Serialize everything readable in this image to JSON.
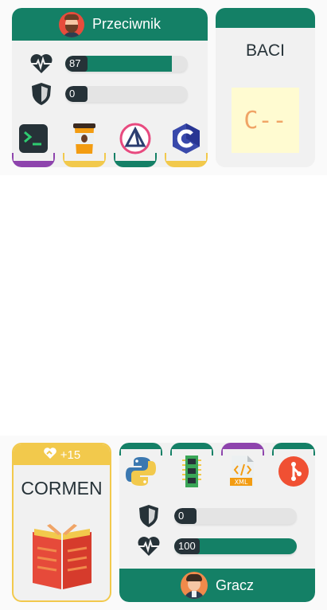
{
  "opponent": {
    "name": "Przeciwnik",
    "health": 87,
    "health_fraction": 0.87,
    "shield": 0,
    "shield_fraction": 0,
    "hand": [
      {
        "icon": "terminal-icon",
        "color": "#8e44ad"
      },
      {
        "icon": "coffee-cup-icon",
        "color": "#f2c94c"
      },
      {
        "icon": "triangle-logo-icon",
        "color": "#148066"
      },
      {
        "icon": "c-language-icon",
        "color": "#f2c94c"
      }
    ]
  },
  "opponent_card": {
    "title": "BACI",
    "art_text": "C--",
    "header_color": "#148066"
  },
  "player_card": {
    "bonus": "+15",
    "title": "CORMEN",
    "art_icon": "book-icon",
    "header_color": "#f2c94c"
  },
  "player": {
    "name": "Gracz",
    "shield": 0,
    "shield_fraction": 0,
    "health": 100,
    "health_fraction": 1.0,
    "hand": [
      {
        "icon": "python-icon",
        "color": "#148066"
      },
      {
        "icon": "ram-stick-icon",
        "color": "#148066"
      },
      {
        "icon": "xml-file-icon",
        "color": "#8e44ad"
      },
      {
        "icon": "git-icon",
        "color": "#148066"
      }
    ]
  },
  "colors": {
    "accent": "#148066",
    "dark": "#263238",
    "yellow": "#f2c94c",
    "purple": "#8e44ad"
  }
}
